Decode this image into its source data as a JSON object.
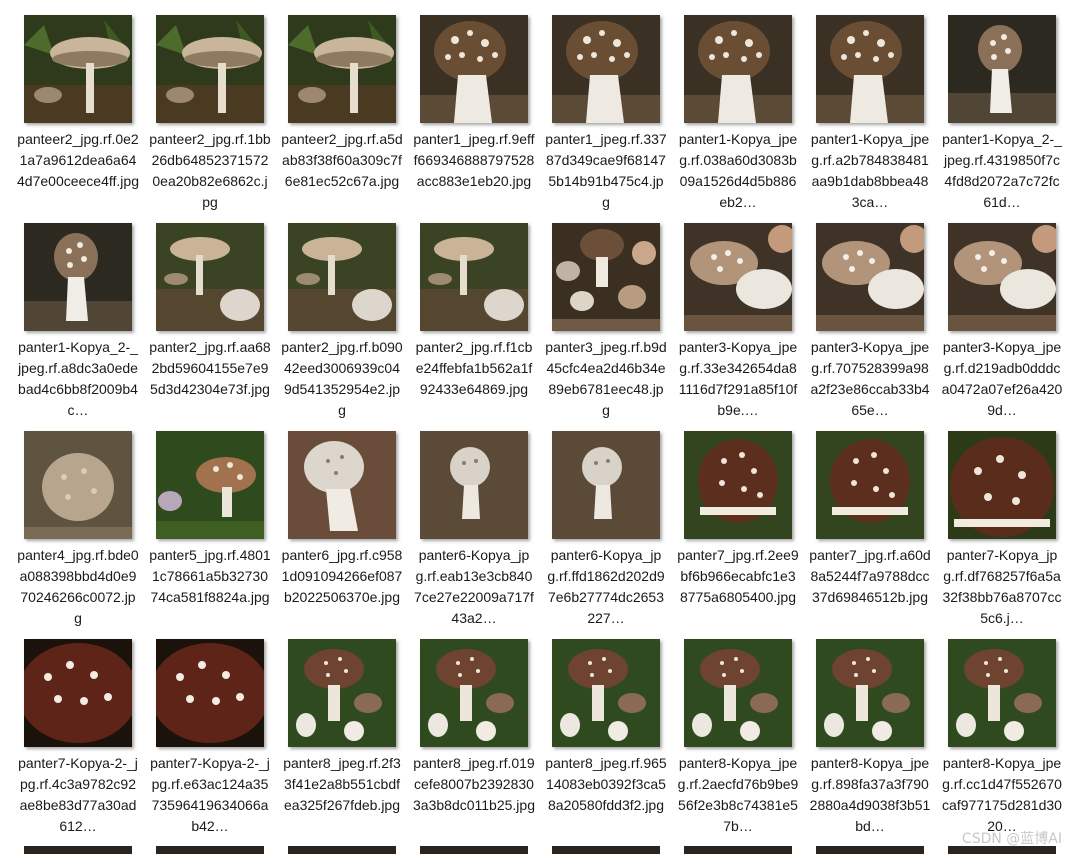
{
  "watermark": "CSDN @蓝博AI",
  "files": [
    {
      "name": "panteer2_jpg.rf.0e21a7a9612dea6a644d7e00ceece4ff.jpg",
      "scene": "flat"
    },
    {
      "name": "panteer2_jpg.rf.1bb26db648523715720ea20b82e6862c.jpg",
      "scene": "flat"
    },
    {
      "name": "panteer2_jpg.rf.a5dab83f38f60a309c7f6e81ec52c67a.jpg",
      "scene": "flat"
    },
    {
      "name": "panter1_jpeg.rf.9efff669346888797528acc883e1eb20.jpg",
      "scene": "tall"
    },
    {
      "name": "panter1_jpeg.rf.33787d349cae9f681475b14b91b475c4.jpg",
      "scene": "tall"
    },
    {
      "name": "panter1-Kopya_jpeg.rf.038a60d3083b09a1526d4d5b886eb2…",
      "scene": "tall"
    },
    {
      "name": "panter1-Kopya_jpeg.rf.a2b784838481aa9b1dab8bbea483ca…",
      "scene": "tall"
    },
    {
      "name": "panter1-Kopya_2-_jpeg.rf.4319850f7c4fd8d2072a7c72fc61d…",
      "scene": "tall_small"
    },
    {
      "name": "panter1-Kopya_2-_jpeg.rf.a8dc3a0edebad4c6bb8f2009b4c…",
      "scene": "tall_small"
    },
    {
      "name": "panter2_jpg.rf.aa682bd59604155e7e95d3d42304e73f.jpg",
      "scene": "flat_pair"
    },
    {
      "name": "panter2_jpg.rf.b09042eed3006939c049d541352954e2.jpg",
      "scene": "flat_pair"
    },
    {
      "name": "panter2_jpg.rf.f1cbe24ffebfa1b562a1f92433e64869.jpg",
      "scene": "flat_pair"
    },
    {
      "name": "panter3_jpeg.rf.b9d45cfc4ea2d46b34e89eb6781eec48.jpg",
      "scene": "cluster"
    },
    {
      "name": "panter3-Kopya_jpeg.rf.33e342654da81116d7f291a85f10fb9e.…",
      "scene": "cluster_close"
    },
    {
      "name": "panter3-Kopya_jpeg.rf.707528399a98a2f23e86ccab33b465e…",
      "scene": "cluster_close"
    },
    {
      "name": "panter3-Kopya_jpeg.rf.d219adb0dddca0472a07ef26a4209d…",
      "scene": "cluster_close"
    },
    {
      "name": "panter4_jpg.rf.bde0a088398bbd4d0e970246266c0072.jpg",
      "scene": "round_pale"
    },
    {
      "name": "panter5_jpg.rf.48011c78661a5b3273074ca581f8824a.jpg",
      "scene": "grass"
    },
    {
      "name": "panter6_jpg.rf.c9581d091094266ef087b2022506370e.jpg",
      "scene": "white"
    },
    {
      "name": "panter6-Kopya_jpg.rf.eab13e3cb8407ce27e22009a717f43a2…",
      "scene": "white_small"
    },
    {
      "name": "panter6-Kopya_jpg.rf.ffd1862d202d97e6b27774dc2653227…",
      "scene": "white_small"
    },
    {
      "name": "panter7_jpg.rf.2ee9bf6b966ecabfc1e38775a6805400.jpg",
      "scene": "dome"
    },
    {
      "name": "panter7_jpg.rf.a60d8a5244f7a9788dcc37d69846512b.jpg",
      "scene": "dome"
    },
    {
      "name": "panter7-Kopya_jpg.rf.df768257f6a5a32f38bb76a8707cc5c6.j…",
      "scene": "dome_big"
    },
    {
      "name": "panter7-Kopya-2-_jpg.rf.4c3a9782c92ae8be83d77a30ad612…",
      "scene": "dome_zoom"
    },
    {
      "name": "panter7-Kopya-2-_jpg.rf.e63ac124a3573596419634066ab42…",
      "scene": "dome_zoom"
    },
    {
      "name": "panter8_jpeg.rf.2f33f41e2a8b551cbdfea325f267fdeb.jpg",
      "scene": "group"
    },
    {
      "name": "panter8_jpeg.rf.019cefe8007b23928303a3b8dc011b25.jpg",
      "scene": "group"
    },
    {
      "name": "panter8_jpeg.rf.96514083eb0392f3ca58a20580fdd3f2.jpg",
      "scene": "group"
    },
    {
      "name": "panter8-Kopya_jpeg.rf.2aecfd76b9be956f2e3b8c74381e57b…",
      "scene": "group"
    },
    {
      "name": "panter8-Kopya_jpeg.rf.898fa37a3f7902880a4d9038f3b51bd…",
      "scene": "group"
    },
    {
      "name": "panter8-Kopya_jpeg.rf.cc1d47f552670caf977175d281d3020…",
      "scene": "group"
    }
  ]
}
